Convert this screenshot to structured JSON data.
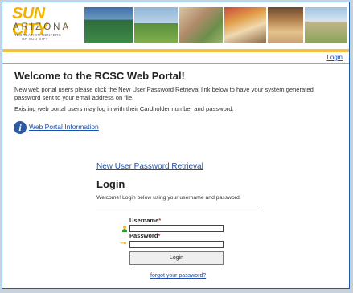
{
  "header": {
    "logo": {
      "brand_top": "SUN CITY",
      "brand_mid": "ARIZONA",
      "brand_sub1": "RECREATION CENTERS",
      "brand_sub2": "OF SUN CITY"
    },
    "photo_strip_icon": "recreation-photos",
    "login_link": "Login"
  },
  "main": {
    "title": "Welcome to the RCSC Web Portal!",
    "intro": "New web portal users please click the New User Password Retrieval link below to have your system generated password sent to your email address on file.",
    "existing": "Existing web portal users may log in with their Cardholder number and password.",
    "info_icon": "info-icon",
    "info_link": "Web Portal Information",
    "new_user_link": "New User Password Retrieval"
  },
  "login": {
    "title": "Login",
    "welcome": "Welcome! Login below using your username and password.",
    "username_label": "Username",
    "password_label": "Password",
    "required_mark": "*",
    "username_value": "",
    "password_value": "",
    "submit_label": "Login",
    "forgot_link": "forgot your password?"
  },
  "colors": {
    "accent_bar": "#f6c141",
    "link": "#1a4fb0",
    "frame_border": "#1e5aa8",
    "page_bg": "#c7d2dc"
  }
}
